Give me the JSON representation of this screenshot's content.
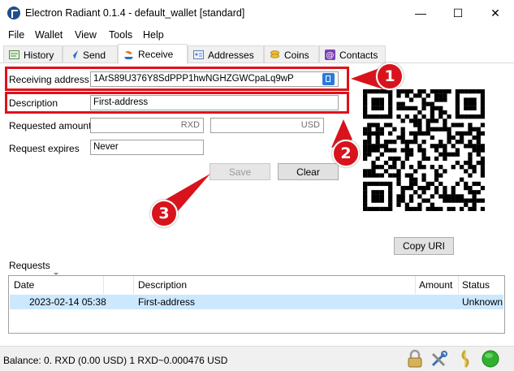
{
  "window": {
    "title": "Electron Radiant 0.1.4  -  default_wallet  [standard]",
    "minimize": "—",
    "maximize": "☐",
    "close": "✕"
  },
  "menu": [
    "File",
    "Wallet",
    "View",
    "Tools",
    "Help"
  ],
  "tabs": [
    {
      "label": "History",
      "icon": "history-icon"
    },
    {
      "label": "Send",
      "icon": "send-icon"
    },
    {
      "label": "Receive",
      "icon": "receive-icon"
    },
    {
      "label": "Addresses",
      "icon": "addresses-icon"
    },
    {
      "label": "Coins",
      "icon": "coins-icon"
    },
    {
      "label": "Contacts",
      "icon": "contacts-icon"
    }
  ],
  "active_tab": "Receive",
  "form": {
    "receiving_address_label": "Receiving address",
    "receiving_address_value": "1ArS89U376Y8SdPPP1hwNGHZGWCpaLq9wP",
    "description_label": "Description",
    "description_value": "First-address",
    "requested_amount_label": "Requested amount",
    "amount_unit": "RXD",
    "fiat_unit": "USD",
    "request_expires_label": "Request expires",
    "request_expires_value": "Never",
    "save_label": "Save",
    "clear_label": "Clear",
    "copy_uri_label": "Copy URI"
  },
  "callouts": [
    "1",
    "2",
    "3"
  ],
  "requests": {
    "title": "Requests",
    "columns": [
      "Date",
      "Description",
      "Amount",
      "Status"
    ],
    "rows": [
      {
        "date": "2023-02-14 05:38",
        "description": "First-address",
        "amount": "",
        "status": "Unknown"
      }
    ]
  },
  "status": {
    "balance": "Balance: 0. RXD (0.00 USD) 1 RXD~0.000476 USD"
  },
  "colors": {
    "highlight_red": "#e0101a",
    "callout_red": "#d8131c",
    "selected_row": "#cce8ff",
    "status_green": "#2fb12f"
  }
}
